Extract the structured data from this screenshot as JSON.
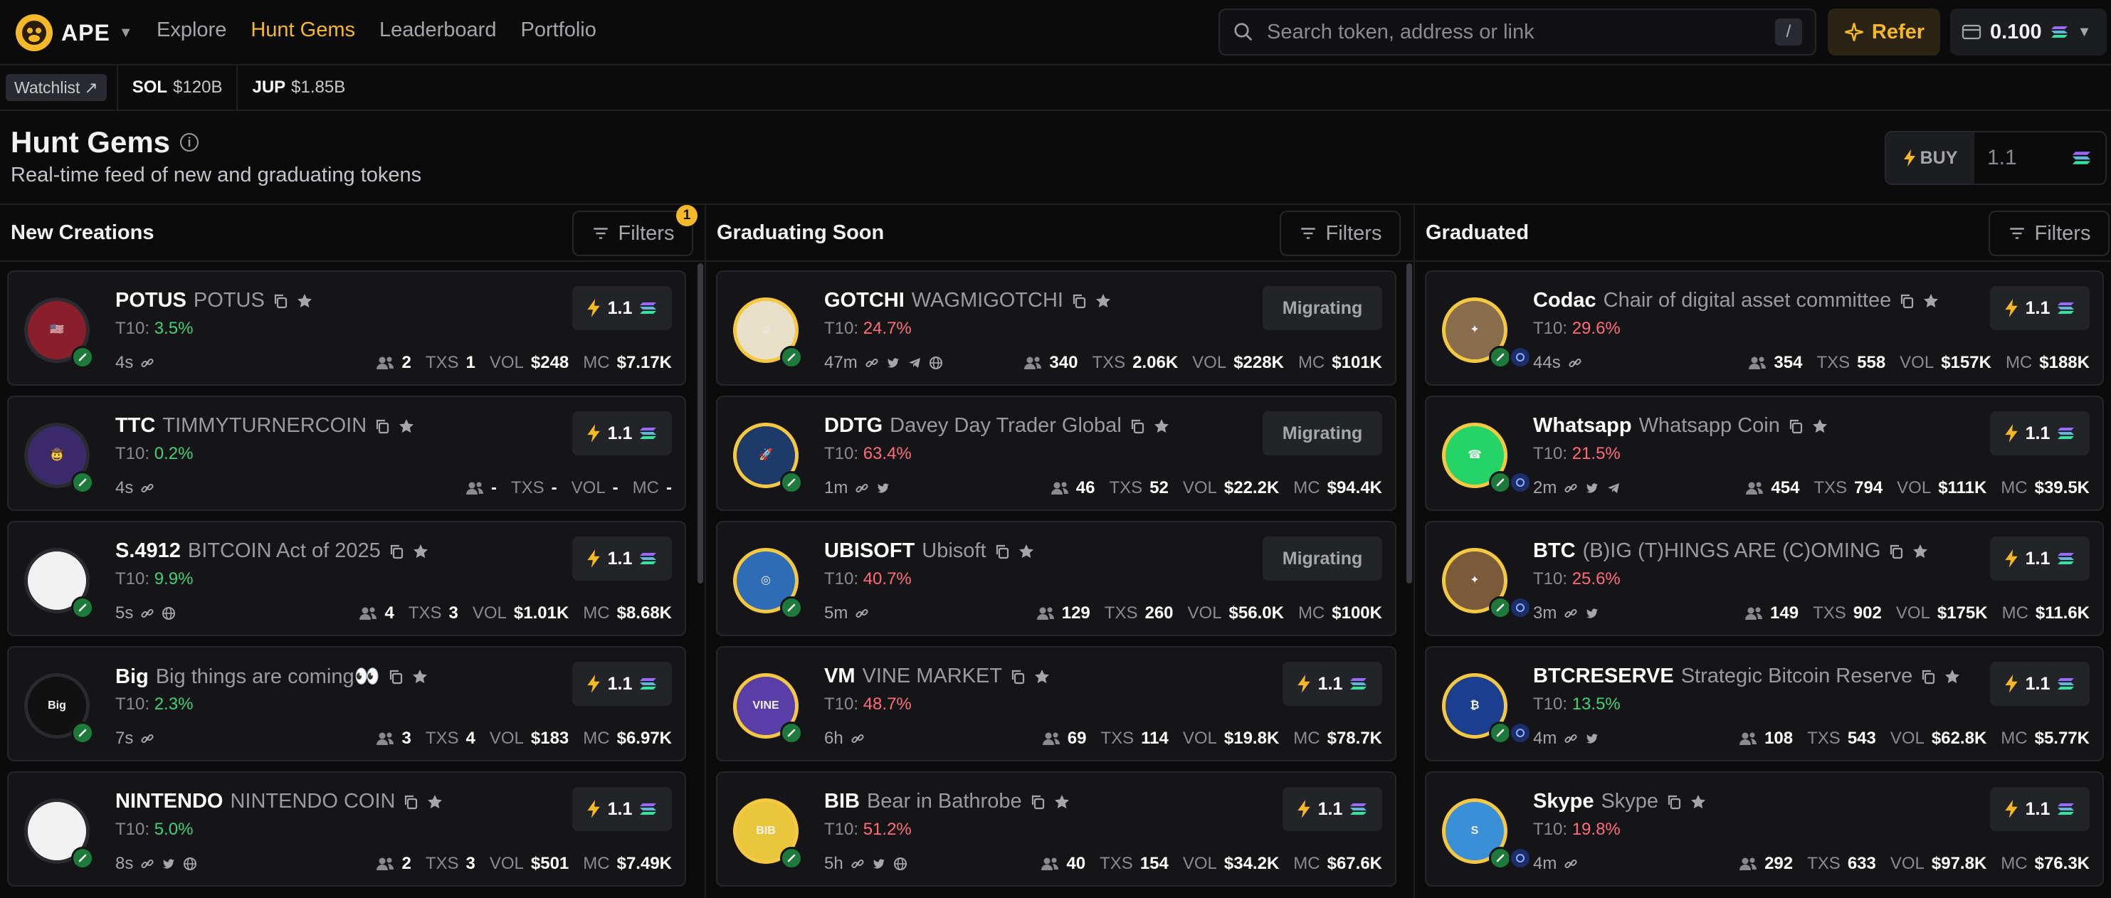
{
  "brand": {
    "name": "APE"
  },
  "nav": {
    "items": [
      "Explore",
      "Hunt Gems",
      "Leaderboard",
      "Portfolio"
    ],
    "active": "Hunt Gems"
  },
  "search": {
    "placeholder": "Search token, address or link",
    "shortcut": "/"
  },
  "refer": {
    "label": "Refer"
  },
  "wallet": {
    "balance": "0.100"
  },
  "subbar": {
    "watchlist": "Watchlist",
    "tickers": [
      {
        "sym": "SOL",
        "val": "$120B"
      },
      {
        "sym": "JUP",
        "val": "$1.85B"
      }
    ]
  },
  "header": {
    "title": "Hunt Gems",
    "subtitle": "Real-time feed of new and graduating tokens",
    "buy_label": "BUY",
    "buy_amount": "1.1"
  },
  "colors": {
    "accent": "#f5b829",
    "green": "#3fd17a",
    "red": "#ff6b7a",
    "card": "#151518"
  },
  "labels": {
    "t10": "T10:",
    "txs": "TXS",
    "vol": "VOL",
    "mc": "MC",
    "buy_amount": "1.1",
    "migrating": "Migrating",
    "filters": "Filters"
  },
  "columns": [
    {
      "title": "New Creations",
      "filter_badge": "1",
      "tokens": [
        {
          "sym": "POTUS",
          "name": "POTUS",
          "t10": "3.5%",
          "trend": "up",
          "age": "4s",
          "holders": "2",
          "txs": "1",
          "vol": "$248",
          "mc": "$7.17K",
          "icons": [
            "link"
          ]
        },
        {
          "sym": "TTC",
          "name": "TIMMYTURNERCOIN",
          "t10": "0.2%",
          "trend": "up",
          "age": "4s",
          "holders": "-",
          "txs": "-",
          "vol": "-",
          "mc": "-",
          "icons": [
            "link"
          ]
        },
        {
          "sym": "S.4912",
          "name": "BITCOIN Act of 2025",
          "t10": "9.9%",
          "trend": "up",
          "age": "5s",
          "holders": "4",
          "txs": "3",
          "vol": "$1.01K",
          "mc": "$8.68K",
          "icons": [
            "link",
            "globe"
          ]
        },
        {
          "sym": "Big",
          "name": "Big things are coming👀",
          "t10": "2.3%",
          "trend": "up",
          "age": "7s",
          "holders": "3",
          "txs": "4",
          "vol": "$183",
          "mc": "$6.97K",
          "icons": [
            "link"
          ]
        },
        {
          "sym": "NINTENDO",
          "name": "NINTENDO COIN",
          "t10": "5.0%",
          "trend": "up",
          "age": "8s",
          "holders": "2",
          "txs": "3",
          "vol": "$501",
          "mc": "$7.49K",
          "icons": [
            "link",
            "twitter",
            "globe"
          ]
        }
      ]
    },
    {
      "title": "Graduating Soon",
      "tokens": [
        {
          "sym": "GOTCHI",
          "name": "WAGMIGOTCHI",
          "t10": "24.7%",
          "trend": "down",
          "age": "47m",
          "holders": "340",
          "txs": "2.06K",
          "vol": "$228K",
          "mc": "$101K",
          "status": "Migrating",
          "icons": [
            "link",
            "twitter",
            "telegram",
            "globe"
          ]
        },
        {
          "sym": "DDTG",
          "name": "Davey Day Trader Global",
          "t10": "63.4%",
          "trend": "down",
          "age": "1m",
          "holders": "46",
          "txs": "52",
          "vol": "$22.2K",
          "mc": "$94.4K",
          "status": "Migrating",
          "icons": [
            "link",
            "twitter"
          ]
        },
        {
          "sym": "UBISOFT",
          "name": "Ubisoft",
          "t10": "40.7%",
          "trend": "down",
          "age": "5m",
          "holders": "129",
          "txs": "260",
          "vol": "$56.0K",
          "mc": "$100K",
          "status": "Migrating",
          "icons": [
            "link"
          ]
        },
        {
          "sym": "VM",
          "name": "VINE MARKET",
          "t10": "48.7%",
          "trend": "down",
          "age": "6h",
          "holders": "69",
          "txs": "114",
          "vol": "$19.8K",
          "mc": "$78.7K",
          "icons": [
            "link"
          ]
        },
        {
          "sym": "BIB",
          "name": "Bear in Bathrobe",
          "t10": "51.2%",
          "trend": "down",
          "age": "5h",
          "holders": "40",
          "txs": "154",
          "vol": "$34.2K",
          "mc": "$67.6K",
          "icons": [
            "link",
            "twitter",
            "globe"
          ]
        }
      ]
    },
    {
      "title": "Graduated",
      "tokens": [
        {
          "sym": "Codac",
          "name": "Chair of digital asset committee",
          "t10": "29.6%",
          "trend": "down",
          "age": "44s",
          "holders": "354",
          "txs": "558",
          "vol": "$157K",
          "mc": "$188K",
          "icons": [
            "link"
          ]
        },
        {
          "sym": "Whatsapp",
          "name": "Whatsapp Coin",
          "t10": "21.5%",
          "trend": "down",
          "age": "2m",
          "holders": "454",
          "txs": "794",
          "vol": "$111K",
          "mc": "$39.5K",
          "icons": [
            "link",
            "twitter",
            "telegram"
          ]
        },
        {
          "sym": "BTC",
          "name": "(B)IG (T)HINGS ARE (C)OMING",
          "t10": "25.6%",
          "trend": "down",
          "age": "3m",
          "holders": "149",
          "txs": "902",
          "vol": "$175K",
          "mc": "$11.6K",
          "icons": [
            "link",
            "twitter"
          ]
        },
        {
          "sym": "BTCRESERVE",
          "name": "Strategic Bitcoin Reserve",
          "t10": "13.5%",
          "trend": "up",
          "age": "4m",
          "holders": "108",
          "txs": "543",
          "vol": "$62.8K",
          "mc": "$5.77K",
          "icons": [
            "link",
            "twitter"
          ]
        },
        {
          "sym": "Skype",
          "name": "Skype",
          "t10": "19.8%",
          "trend": "down",
          "age": "4m",
          "holders": "292",
          "txs": "633",
          "vol": "$97.8K",
          "mc": "$76.3K",
          "icons": [
            "link"
          ]
        }
      ]
    }
  ]
}
